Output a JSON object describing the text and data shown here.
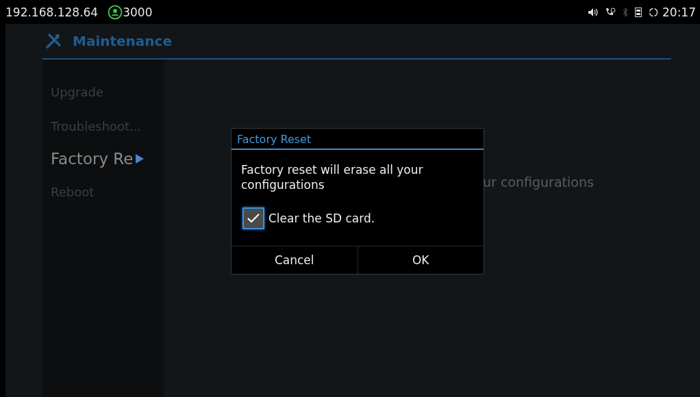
{
  "status_bar": {
    "ip": "192.168.128.64",
    "account": "3000",
    "time": "20:17"
  },
  "header": {
    "title": "Maintenance"
  },
  "sidebar": {
    "items": [
      {
        "label": "Upgrade",
        "selected": false
      },
      {
        "label": "Troubleshoot...",
        "selected": false
      },
      {
        "label": "Factory Re",
        "selected": true
      },
      {
        "label": "Reboot",
        "selected": false
      }
    ]
  },
  "content": {
    "text": "ur configurations"
  },
  "dialog": {
    "title": "Factory Reset",
    "message": "Factory reset will erase all your configurations",
    "checkbox": {
      "label": "Clear the SD card.",
      "checked": true
    },
    "buttons": [
      "Cancel",
      "OK"
    ]
  }
}
